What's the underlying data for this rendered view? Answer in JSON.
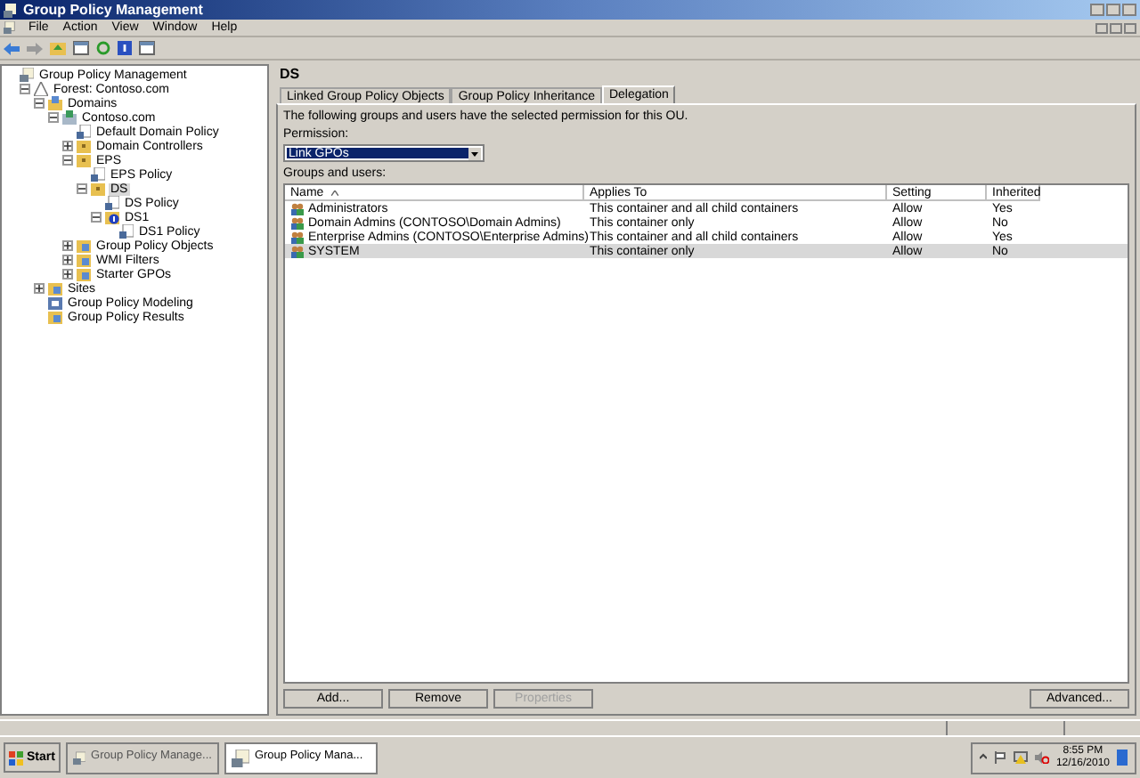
{
  "window": {
    "title": "Group Policy Management"
  },
  "menu": [
    "File",
    "Action",
    "View",
    "Window",
    "Help"
  ],
  "tree": [
    {
      "label": "Group Policy Management",
      "kind": "console",
      "selected": false,
      "children": [
        {
          "label": "Forest: Contoso.com",
          "kind": "forest",
          "expanded": true,
          "selected": false,
          "children": [
            {
              "label": "Domains",
              "kind": "domains",
              "expanded": true,
              "selected": false,
              "children": [
                {
                  "label": "Contoso.com",
                  "kind": "domain",
                  "expanded": true,
                  "selected": false,
                  "children": [
                    {
                      "label": "Default Domain Policy",
                      "kind": "policy",
                      "selected": false
                    },
                    {
                      "label": "Domain Controllers",
                      "kind": "ou",
                      "expanded": false,
                      "selected": false
                    },
                    {
                      "label": "EPS",
                      "kind": "ou",
                      "expanded": true,
                      "selected": false,
                      "children": [
                        {
                          "label": "EPS Policy",
                          "kind": "policy",
                          "selected": false
                        },
                        {
                          "label": "DS",
                          "kind": "ou",
                          "expanded": true,
                          "selected": true,
                          "children": [
                            {
                              "label": "DS Policy",
                              "kind": "policy",
                              "selected": false
                            },
                            {
                              "label": "DS1",
                              "kind": "ou-blocked",
                              "expanded": true,
                              "selected": false,
                              "children": [
                                {
                                  "label": "DS1 Policy",
                                  "kind": "policy",
                                  "selected": false
                                }
                              ]
                            }
                          ]
                        }
                      ]
                    },
                    {
                      "label": "Group Policy Objects",
                      "kind": "folder",
                      "expanded": false,
                      "selected": false
                    },
                    {
                      "label": "WMI Filters",
                      "kind": "folder",
                      "expanded": false,
                      "selected": false
                    },
                    {
                      "label": "Starter GPOs",
                      "kind": "folder",
                      "expanded": false,
                      "selected": false
                    }
                  ]
                }
              ]
            },
            {
              "label": "Sites",
              "kind": "folder",
              "expanded": false,
              "selected": false
            },
            {
              "label": "Group Policy Modeling",
              "kind": "modeling",
              "selected": false
            },
            {
              "label": "Group Policy Results",
              "kind": "folder",
              "selected": false
            }
          ]
        }
      ]
    }
  ],
  "pane": {
    "title": "DS",
    "tabs": [
      {
        "label": "Linked Group Policy Objects",
        "selected": false
      },
      {
        "label": "Group Policy Inheritance",
        "selected": false
      },
      {
        "label": "Delegation",
        "selected": true
      }
    ],
    "description": "The following groups and users have the selected permission for this OU.",
    "permission_label": "Permission:",
    "permission_value": "Link GPOs",
    "list_label": "Groups and users:",
    "columns": [
      "Name",
      "Applies To",
      "Setting",
      "Inherited"
    ],
    "rows": [
      {
        "cells": [
          "Administrators",
          "This container and all child containers",
          "Allow",
          "Yes"
        ],
        "selected": false
      },
      {
        "cells": [
          "Domain Admins (CONTOSO\\Domain Admins)",
          "This container only",
          "Allow",
          "No"
        ],
        "selected": false
      },
      {
        "cells": [
          "Enterprise Admins (CONTOSO\\Enterprise Admins)",
          "This container and all child containers",
          "Allow",
          "Yes"
        ],
        "selected": false
      },
      {
        "cells": [
          "SYSTEM",
          "This container only",
          "Allow",
          "No"
        ],
        "selected": true
      }
    ],
    "buttons": [
      {
        "label": "Add...",
        "disabled": false
      },
      {
        "label": "Remove",
        "disabled": false
      },
      {
        "label": "Properties",
        "disabled": true
      }
    ],
    "advanced_button": {
      "label": "Advanced...",
      "disabled": false
    }
  },
  "taskbar": {
    "start": "Start",
    "tasks": [
      {
        "label": "Group Policy Manage...",
        "selected": false
      },
      {
        "label": "Group Policy Mana...",
        "selected": true
      }
    ],
    "time": "8:55 PM",
    "date": "12/16/2010"
  }
}
